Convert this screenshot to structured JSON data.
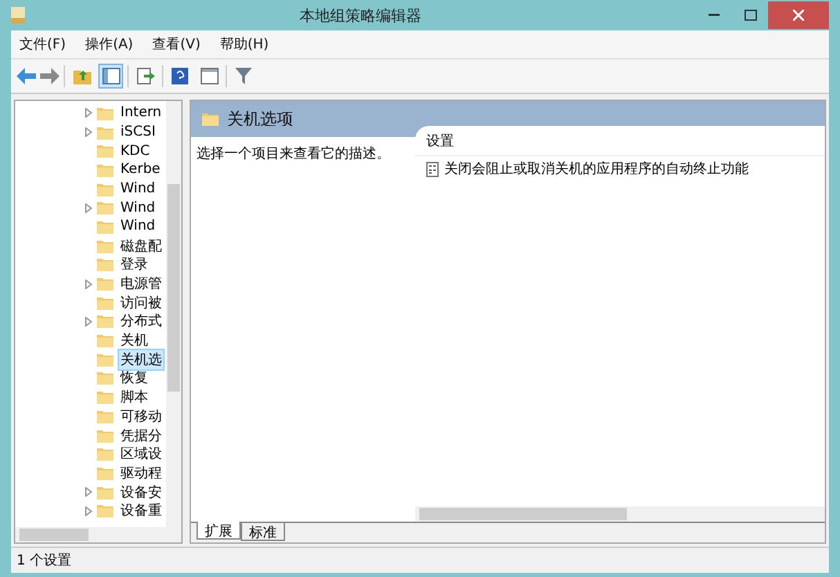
{
  "window": {
    "title": "本地组策略编辑器"
  },
  "menu": [
    {
      "label": "文件(F)"
    },
    {
      "label": "操作(A)"
    },
    {
      "label": "查看(V)"
    },
    {
      "label": "帮助(H)"
    }
  ],
  "toolbar": [
    {
      "kind": "back"
    },
    {
      "kind": "forward"
    },
    {
      "kind": "sep"
    },
    {
      "kind": "up",
      "selected": false
    },
    {
      "kind": "pane",
      "selected": true
    },
    {
      "kind": "sep"
    },
    {
      "kind": "export",
      "selected": false
    },
    {
      "kind": "sep"
    },
    {
      "kind": "help",
      "selected": false
    },
    {
      "kind": "view",
      "selected": false
    },
    {
      "kind": "sep"
    },
    {
      "kind": "filter",
      "selected": false
    }
  ],
  "tree": [
    {
      "label": "Intern",
      "expandable": true,
      "selected": false
    },
    {
      "label": "iSCSI",
      "expandable": true,
      "selected": false
    },
    {
      "label": "KDC",
      "expandable": false,
      "selected": false
    },
    {
      "label": "Kerbe",
      "expandable": false,
      "selected": false
    },
    {
      "label": "Wind",
      "expandable": false,
      "selected": false
    },
    {
      "label": "Wind",
      "expandable": true,
      "selected": false
    },
    {
      "label": "Wind",
      "expandable": false,
      "selected": false
    },
    {
      "label": "磁盘配",
      "expandable": false,
      "selected": false
    },
    {
      "label": "登录",
      "expandable": false,
      "selected": false
    },
    {
      "label": "电源管",
      "expandable": true,
      "selected": false
    },
    {
      "label": "访问被",
      "expandable": false,
      "selected": false
    },
    {
      "label": "分布式",
      "expandable": true,
      "selected": false
    },
    {
      "label": "关机",
      "expandable": false,
      "selected": false
    },
    {
      "label": "关机选",
      "expandable": false,
      "selected": true
    },
    {
      "label": "恢复",
      "expandable": false,
      "selected": false
    },
    {
      "label": "脚本",
      "expandable": false,
      "selected": false
    },
    {
      "label": "可移动",
      "expandable": false,
      "selected": false
    },
    {
      "label": "凭据分",
      "expandable": false,
      "selected": false
    },
    {
      "label": "区域设",
      "expandable": false,
      "selected": false
    },
    {
      "label": "驱动程",
      "expandable": false,
      "selected": false
    },
    {
      "label": "设备安",
      "expandable": true,
      "selected": false
    },
    {
      "label": "设备重",
      "expandable": true,
      "selected": false
    }
  ],
  "details": {
    "heading": "关机选项",
    "description": "选择一个项目来查看它的描述。",
    "column": "设置",
    "settings": [
      {
        "label": "关闭会阻止或取消关机的应用程序的自动终止功能"
      }
    ]
  },
  "view_tabs": [
    {
      "label": "扩展",
      "selected": true
    },
    {
      "label": "标准",
      "selected": false
    }
  ],
  "status_bar": "1 个设置"
}
